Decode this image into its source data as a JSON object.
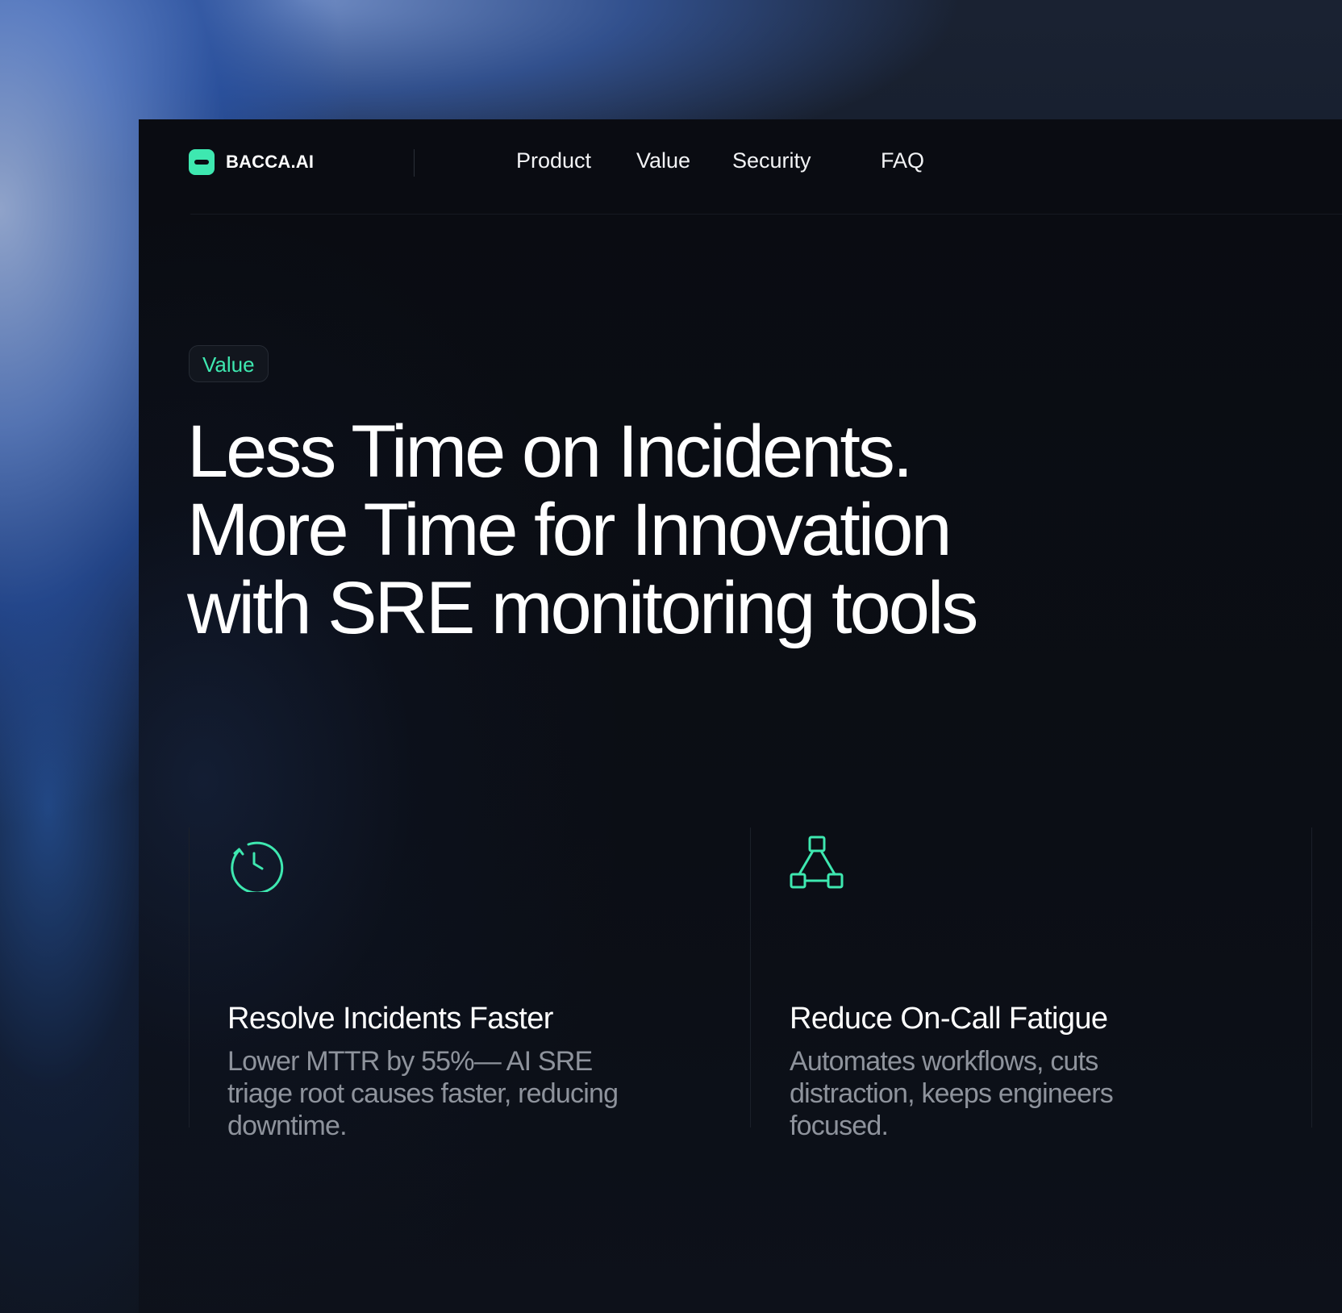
{
  "nav": {
    "brand": "BACCA.AI",
    "links": [
      "Product",
      "Value",
      "Security",
      "FAQ"
    ]
  },
  "hero": {
    "badge": "Value",
    "headline": [
      "Less Time on Incidents.",
      "More Time for Innovation",
      "with SRE monitoring tools"
    ]
  },
  "features": [
    {
      "icon": "clock-rewind-icon",
      "title": "Resolve Incidents Faster",
      "description": "Lower MTTR by 55%— AI SRE triage root causes faster, reducing downtime."
    },
    {
      "icon": "workflow-nodes-icon",
      "title": "Reduce On-Call Fatigue",
      "description": "Automates workflows, cuts distraction, keeps engineers focused."
    }
  ],
  "colors": {
    "accent": "#3ee8b0",
    "background": "#0a0c12",
    "text": "#ffffff",
    "muted_text": "#8e939c"
  }
}
